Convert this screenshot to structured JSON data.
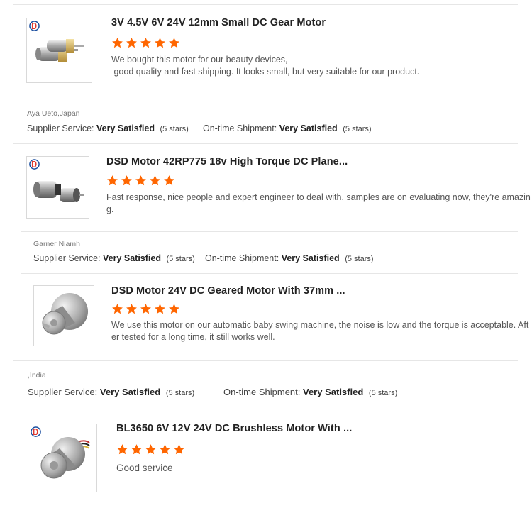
{
  "accent": "#ff6600",
  "reviews": [
    {
      "product": "3V 4.5V 6V 24V 12mm Small DC Gear Motor",
      "stars": 5,
      "text_line1": "We bought this motor for our beauty devices,",
      "text_line2": " good quality and fast shipping. It looks small, but very suitable for our product.",
      "image_icon": "mini-gear-motor-image",
      "reviewer": "Aya Ueto,Japan",
      "supplier_label": "Supplier Service:",
      "supplier_value": "Very Satisfied",
      "supplier_count": "(5 stars)",
      "shipment_label": "On-time Shipment:",
      "shipment_value": "Very Satisfied",
      "shipment_count": "(5 stars)"
    },
    {
      "product": "DSD Motor 42RP775 18v High Torque DC Plane...",
      "stars": 5,
      "text_line1": "Fast response, nice people and expert engineer to deal with, samples are on evaluating now, they're amazin",
      "text_line2": "g.",
      "image_icon": "planetary-gear-motor-image",
      "reviewer": "Garner Niamh",
      "supplier_label": "Supplier Service:",
      "supplier_value": "Very Satisfied",
      "supplier_count": "(5 stars)",
      "shipment_label": "On-time Shipment:",
      "shipment_value": "Very Satisfied",
      "shipment_count": "(5 stars)"
    },
    {
      "product": "DSD Motor 24V DC Geared Motor With 37mm ...",
      "stars": 5,
      "text_line1": "We use this motor on our automatic baby swing machine, the noise is low and the torque is acceptable. Aft",
      "text_line2": "er tested for a long time, it still works well.",
      "image_icon": "geared-motor-37mm-image",
      "reviewer": ",India",
      "supplier_label": "Supplier Service:",
      "supplier_value": "Very Satisfied",
      "supplier_count": "(5 stars)",
      "shipment_label": "On-time Shipment:",
      "shipment_value": "Very Satisfied",
      "shipment_count": "(5 stars)"
    },
    {
      "product": "BL3650 6V 12V 24V DC Brushless Motor With ...",
      "stars": 5,
      "text_line1": "Good service",
      "image_icon": "brushless-motor-image"
    }
  ]
}
